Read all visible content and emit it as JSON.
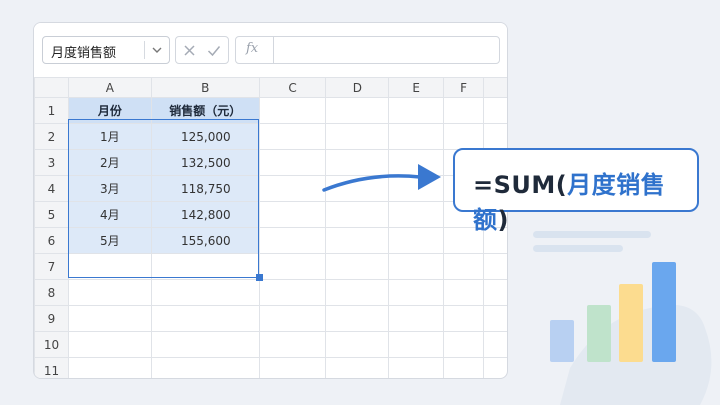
{
  "toolbar": {
    "namebox_value": "月度销售额",
    "fx_label": "fx",
    "formula_value": ""
  },
  "columns": [
    "A",
    "B",
    "C",
    "D",
    "E",
    "F"
  ],
  "rows": [
    "1",
    "2",
    "3",
    "4",
    "5",
    "6",
    "7",
    "8",
    "9",
    "10",
    "11"
  ],
  "table": {
    "header": [
      "月份",
      "销售额（元）"
    ],
    "data": [
      [
        "1月",
        "125,000"
      ],
      [
        "2月",
        "132,500"
      ],
      [
        "3月",
        "118,750"
      ],
      [
        "4月",
        "142,800"
      ],
      [
        "5月",
        "155,600"
      ]
    ]
  },
  "formula_card": {
    "eq": "=",
    "fn": "SUM(",
    "arg": "月度销售额",
    "close": ")"
  },
  "colors": {
    "accent": "#3a78d0",
    "selection_fill": "#dde9f8",
    "bar_blue_light": "#b8d0f2",
    "bar_green": "#bfe3cb",
    "bar_yellow": "#fcdc8f",
    "bar_blue": "#6aa7ee"
  },
  "icons": {
    "dropdown": "chevron-down-icon",
    "cancel": "close-icon",
    "confirm": "check-icon"
  }
}
